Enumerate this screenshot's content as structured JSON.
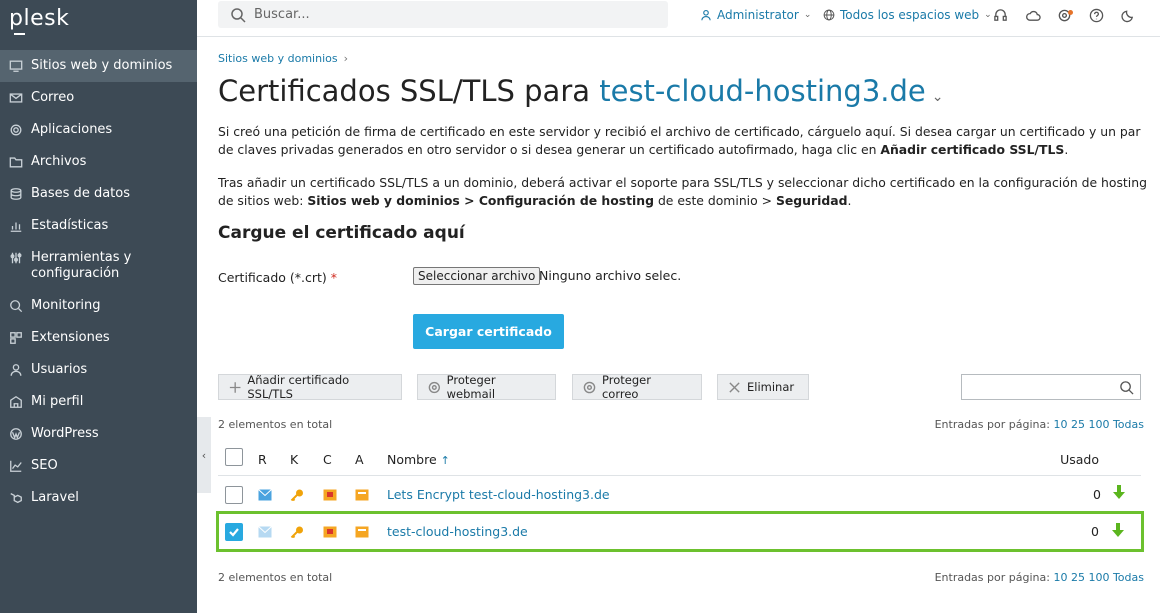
{
  "brand": {
    "logo": "plesk"
  },
  "sidebar": {
    "items": [
      {
        "label": "Sitios web y dominios",
        "icon": "monitor-icon",
        "active": true
      },
      {
        "label": "Correo",
        "icon": "mail-icon"
      },
      {
        "label": "Aplicaciones",
        "icon": "gear-icon"
      },
      {
        "label": "Archivos",
        "icon": "folder-icon"
      },
      {
        "label": "Bases de datos",
        "icon": "database-icon"
      },
      {
        "label": "Estadísticas",
        "icon": "bar-chart-icon"
      },
      {
        "label": "Herramientas y configuración",
        "icon": "sliders-icon"
      },
      {
        "label": "Monitoring",
        "icon": "monitoring-icon"
      },
      {
        "label": "Extensiones",
        "icon": "extensions-icon"
      },
      {
        "label": "Usuarios",
        "icon": "user-icon"
      },
      {
        "label": "Mi perfil",
        "icon": "profile-icon"
      },
      {
        "label": "WordPress",
        "icon": "wordpress-icon"
      },
      {
        "label": "SEO",
        "icon": "seo-icon"
      },
      {
        "label": "Laravel",
        "icon": "laravel-icon"
      }
    ]
  },
  "topbar": {
    "search_placeholder": "Buscar...",
    "account": "Administrator",
    "subscriptions": "Todos los espacios web"
  },
  "breadcrumb": {
    "item": "Sitios web y dominios"
  },
  "page": {
    "title_prefix": "Certificados SSL/TLS para",
    "title_domain": "test-cloud-hosting3.de",
    "para1_a": "Si creó una petición de firma de certificado en este servidor y recibió el archivo de certificado, cárguelo aquí. Si desea cargar un certificado y un par de claves privadas generados en otro servidor o si desea generar un certificado autofirmado, haga clic en ",
    "para1_b": "Añadir certificado SSL/TLS",
    "para1_c": ".",
    "para2_a": "Tras añadir un certificado SSL/TLS a un dominio, deberá activar el soporte para SSL/TLS y seleccionar dicho certificado en la configuración de hosting de sitios web: ",
    "para2_b": "Sitios web y dominios",
    "para2_c": " > ",
    "para2_d": "Configuración de hosting",
    "para2_e": " de este dominio > ",
    "para2_f": "Seguridad",
    "para2_g": ".",
    "section_title": "Cargue el certificado aquí",
    "cert_label": "Certificado (*.crt)",
    "required_mark": "*",
    "file_button": "Seleccionar archivo",
    "file_none": "Ninguno archivo selec.",
    "upload_button": "Cargar certificado"
  },
  "toolbar": {
    "add": "Añadir certificado SSL/TLS",
    "protect_webmail": "Proteger webmail",
    "protect_mail": "Proteger correo",
    "delete": "Eliminar"
  },
  "list": {
    "total": "2 elementos en total",
    "per_page_label": "Entradas por página:",
    "per_page_options": [
      "10",
      "25",
      "100",
      "Todas"
    ],
    "columns": {
      "r": "R",
      "k": "K",
      "c": "C",
      "a": "A",
      "name": "Nombre",
      "sort_indicator": "↑",
      "used": "Usado"
    },
    "rows": [
      {
        "name": "Lets Encrypt test-cloud-hosting3.de",
        "used": "0",
        "checked": false
      },
      {
        "name": "test-cloud-hosting3.de",
        "used": "0",
        "checked": true
      }
    ]
  },
  "colors": {
    "accent": "#28a9e0",
    "link": "#1a7aa8",
    "sidebar": "#3d4a55",
    "selection": "#6cc12e"
  }
}
